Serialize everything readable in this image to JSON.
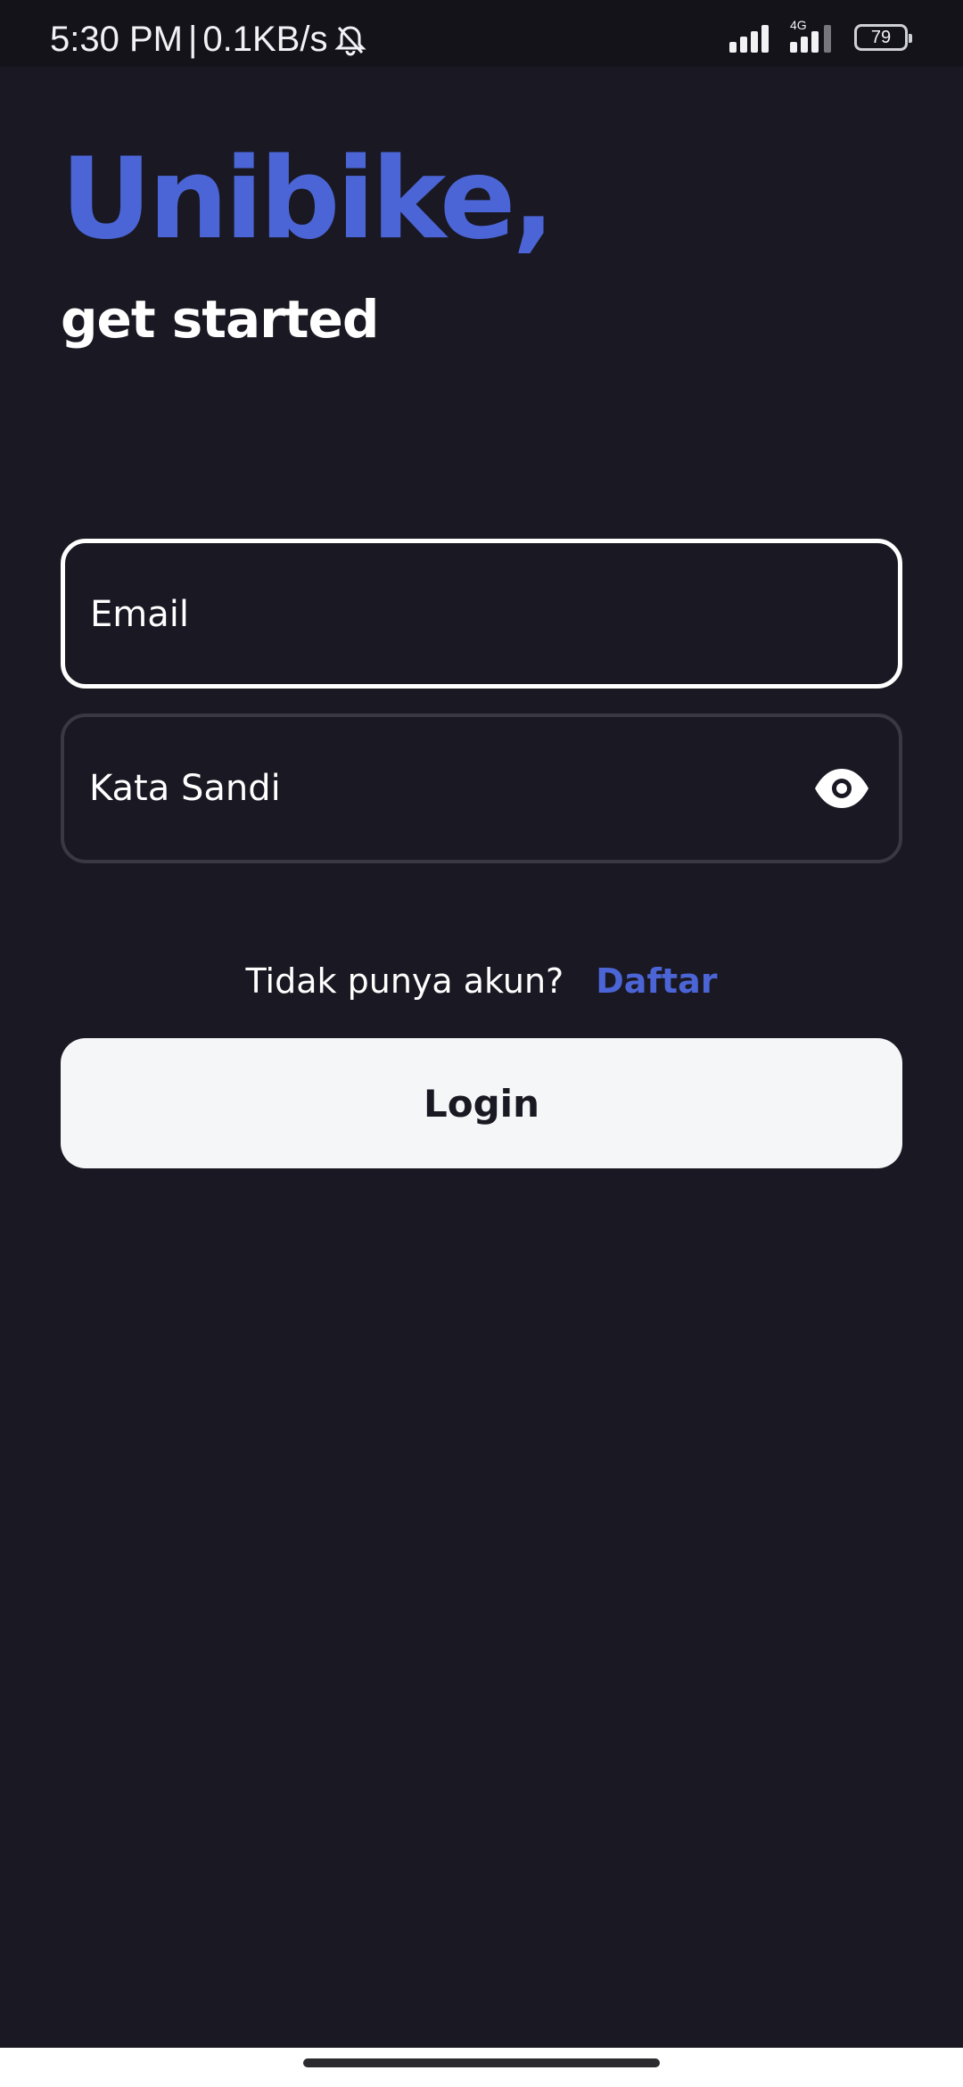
{
  "status_bar": {
    "time": "5:30 PM",
    "separator": "|",
    "network_speed": "0.1KB/s",
    "network_type": "4G",
    "battery_level": "79",
    "icons": {
      "silent": "bell-off-icon",
      "signal_primary": "signal-bars-icon",
      "signal_secondary": "signal-bars-4g-icon",
      "battery": "battery-icon"
    }
  },
  "header": {
    "title": "Unibike,",
    "subtitle": "get started"
  },
  "form": {
    "email": {
      "value": "",
      "placeholder": "Email"
    },
    "password": {
      "value": "",
      "placeholder": "Kata Sandi",
      "toggle_icon": "eye-icon"
    }
  },
  "signup": {
    "prompt": "Tidak punya akun?",
    "link": "Daftar"
  },
  "actions": {
    "login_label": "Login"
  },
  "colors": {
    "background": "#1a1822",
    "accent": "#4b65d6",
    "button_background": "#f5f6f8"
  }
}
